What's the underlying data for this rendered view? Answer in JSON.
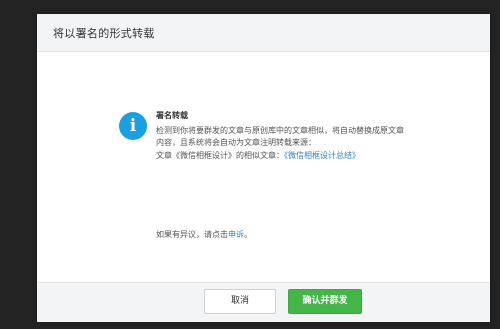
{
  "dialog": {
    "title": "将以署名的形式转载",
    "message": {
      "heading": "署名转载",
      "line1": "检测到你将要群发的文章与原创库中的文章相似，将自动替换成原文章",
      "line2": "内容，且系统将会自动为文章注明转载来源：",
      "source_prefix": "文章《微信相框设计》的相似文章：",
      "source_link": "《微信相框设计总结》",
      "objection_prefix": "如果有异议，请点击",
      "objection_link": "申诉",
      "objection_suffix": "。"
    },
    "buttons": {
      "cancel": "取消",
      "confirm": "确认并群发"
    }
  },
  "colors": {
    "info_icon": "#1a9fe3",
    "link": "#2f7fc9",
    "confirm_button": "#44b549"
  },
  "icons": {
    "info": "info-icon"
  }
}
